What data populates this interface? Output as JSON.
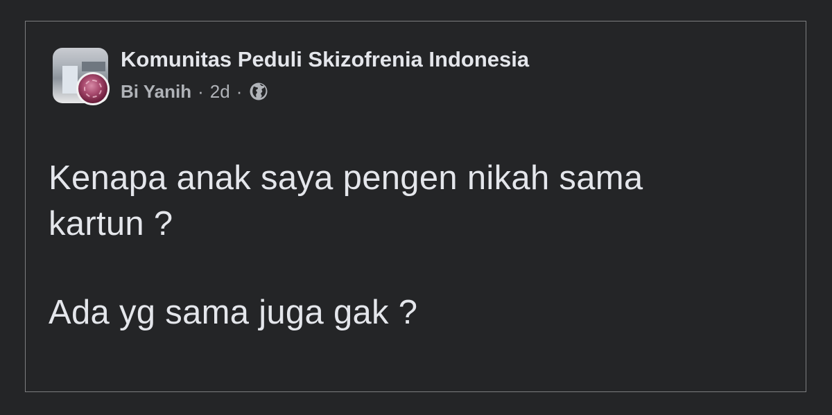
{
  "post": {
    "group_name": "Komunitas Peduli Skizofrenia Indonesia",
    "author": "Bi Yanih",
    "separator": "·",
    "time": "2d",
    "privacy_icon": "globe-icon",
    "body_paragraphs": [
      "Kenapa anak saya pengen nikah sama\nkartun ?",
      "Ada yg sama juga gak ?"
    ]
  },
  "colors": {
    "background": "#242527",
    "border": "#7d7e80",
    "primary_text": "#e4e6eb",
    "secondary_text": "#b0b3b8"
  }
}
